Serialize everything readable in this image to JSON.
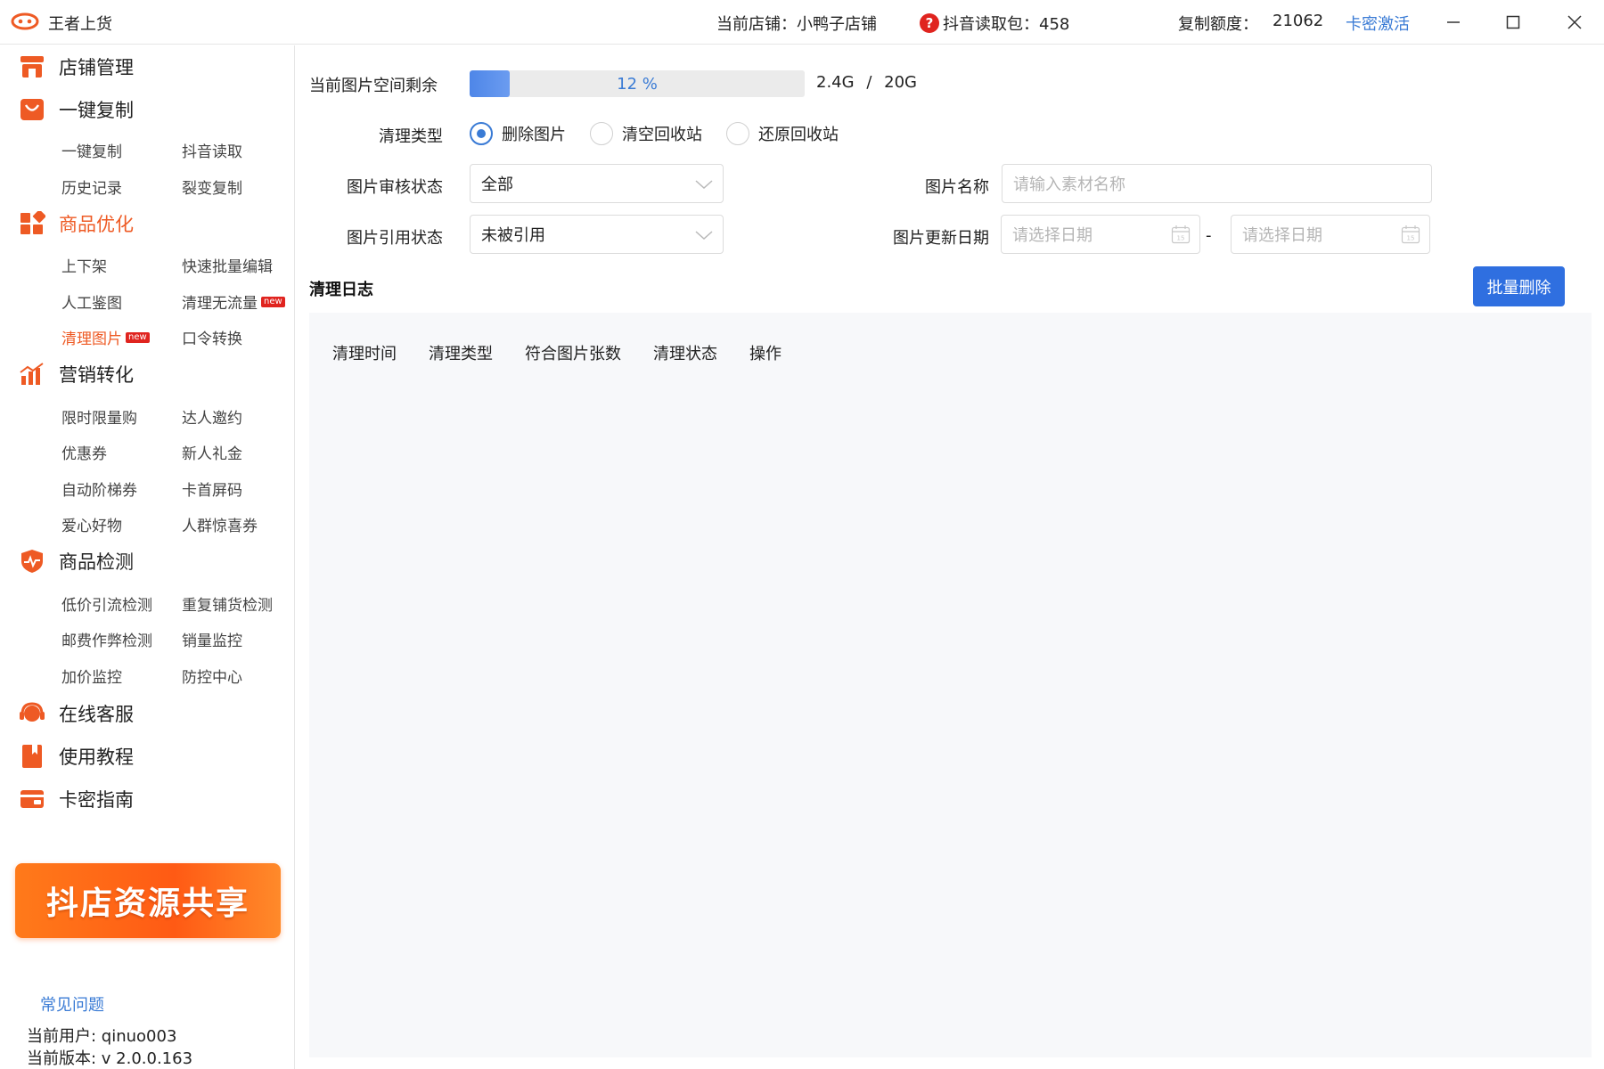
{
  "app": {
    "title": "王者上货"
  },
  "header": {
    "store_label": "当前店铺：小鸭子店铺",
    "douyin_label": "抖音读取包：458",
    "quota_label": "复制额度：",
    "quota_value": "21062",
    "activate_label": "卡密激活"
  },
  "sidebar": {
    "groups": [
      {
        "label": "店铺管理",
        "icon": "store-icon"
      },
      {
        "label": "一键复制",
        "icon": "bag-icon"
      },
      {
        "label": "商品优化",
        "icon": "grid-icon"
      },
      {
        "label": "营销转化",
        "icon": "chart-icon"
      },
      {
        "label": "商品检测",
        "icon": "shield-pulse-icon"
      },
      {
        "label": "在线客服",
        "icon": "headset-icon"
      },
      {
        "label": "使用教程",
        "icon": "book-icon"
      },
      {
        "label": "卡密指南",
        "icon": "card-icon"
      }
    ],
    "sub": {
      "copy": [
        "一键复制",
        "抖音读取",
        "历史记录",
        "裂变复制"
      ],
      "optimize": [
        "上下架",
        "快速批量编辑",
        "人工鉴图",
        "清理无流量",
        "清理图片",
        "口令转换"
      ],
      "marketing": [
        "限时限量购",
        "达人邀约",
        "优惠券",
        "新人礼金",
        "自动阶梯券",
        "卡首屏码",
        "爱心好物",
        "人群惊喜券"
      ],
      "detect": [
        "低价引流检测",
        "重复铺货检测",
        "邮费作弊检测",
        "销量监控",
        "加价监控",
        "防控中心"
      ]
    },
    "new_badge": "new",
    "banner": "抖店资源共享",
    "faq": "常见问题",
    "user": "当前用户: qinuo003",
    "version": "当前版本: v 2.0.0.163"
  },
  "main": {
    "space_label": "当前图片空间剩余",
    "progress_percent": 12,
    "progress_text": "12 %",
    "capacity_used": "2.4G",
    "capacity_sep": "/",
    "capacity_total": "20G",
    "clean_type_label": "清理类型",
    "clean_options": [
      "删除图片",
      "清空回收站",
      "还原回收站"
    ],
    "clean_selected": 0,
    "audit_label": "图片审核状态",
    "audit_value": "全部",
    "name_label": "图片名称",
    "name_placeholder": "请输入素材名称",
    "ref_label": "图片引用状态",
    "ref_value": "未被引用",
    "date_label": "图片更新日期",
    "date_placeholder": "请选择日期",
    "date_sep": "-",
    "log_title": "清理日志",
    "batch_delete": "批量删除",
    "columns": [
      "清理时间",
      "清理类型",
      "符合图片张数",
      "清理状态",
      "操作"
    ]
  },
  "colors": {
    "accent": "#ee5a24",
    "link": "#3a7bd5",
    "primary": "#2f6fe0"
  }
}
